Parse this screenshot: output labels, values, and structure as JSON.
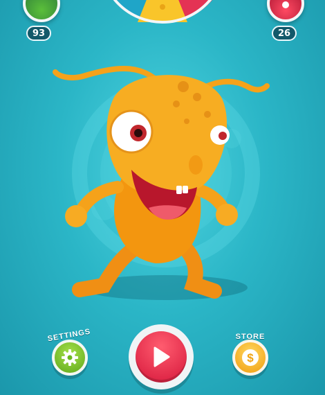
{
  "hud": {
    "left_counter": "93",
    "right_counter": "26"
  },
  "buttons": {
    "settings_label": "SETTINGS",
    "store_label": "STORE",
    "play_icon": "play-icon",
    "settings_icon": "gear-icon",
    "store_icon": "dollar-coin-icon"
  },
  "colors": {
    "background": "#2bb6c7",
    "settings": "#6cb81f",
    "play": "#e3203f",
    "store": "#f3a817",
    "character": "#f5a21a"
  }
}
